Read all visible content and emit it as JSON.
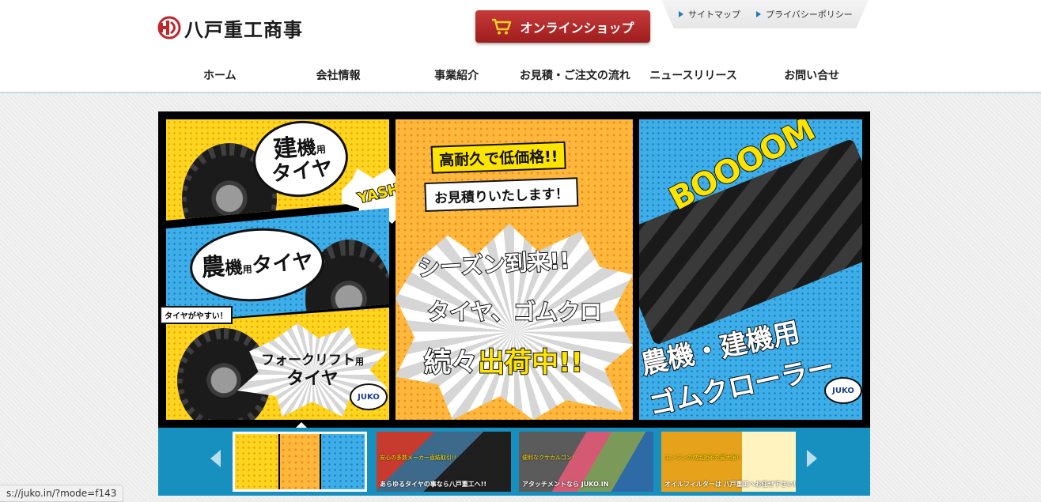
{
  "brand": {
    "name": "八戸重工商事",
    "accent": "#c0272d"
  },
  "header": {
    "shop_button": "オンラインショップ",
    "util_links": [
      "サイトマップ",
      "プライバシーポリシー"
    ]
  },
  "nav": [
    "ホーム",
    "会社情報",
    "事業紹介",
    "お見積・ご注文の流れ",
    "ニュースリリース",
    "お問い合せ"
  ],
  "banner": {
    "panel_left": {
      "construction_tire": [
        "建",
        "機",
        "用",
        "タイヤ"
      ],
      "yashi": "YASHI!",
      "agri_tire": [
        "農",
        "機",
        "用",
        "タイヤ"
      ],
      "cheap_tag": "タイヤがやすい！",
      "forklift": [
        "フォークリフト",
        "用",
        "タイヤ"
      ],
      "juko": "JUKO"
    },
    "panel_center": {
      "line1": "高耐久で低価格!!",
      "line2": "お見積りいたします！",
      "season": "シーズン到来!!",
      "items": "タイヤ、ゴムクロ",
      "shipping_a": "続々",
      "shipping_b": "出荷中!!"
    },
    "panel_right": {
      "boom": "BOOOOM",
      "title": "農機・建機用",
      "title2": "ゴムクローラー",
      "juko": "JUKO"
    }
  },
  "thumbnails": [
    {
      "caption": "",
      "sub": ""
    },
    {
      "caption": "あらゆるタイヤの事なら八戸重工へ!!",
      "sub": "安心の多数メーカー直結取引!!"
    },
    {
      "caption": "アタッチメントなら JUKO.IN",
      "sub": "便利なクサカルゴン!"
    },
    {
      "caption": "オイルフィルターは 八戸重工へお任せ下さい!!",
      "sub": "エンジンの燃焼効率を最大限!!"
    }
  ],
  "status_bar": "s://juko.in/?mode=f143",
  "icons": {
    "cart": "cart-icon",
    "logo": "logo-mark-icon"
  }
}
